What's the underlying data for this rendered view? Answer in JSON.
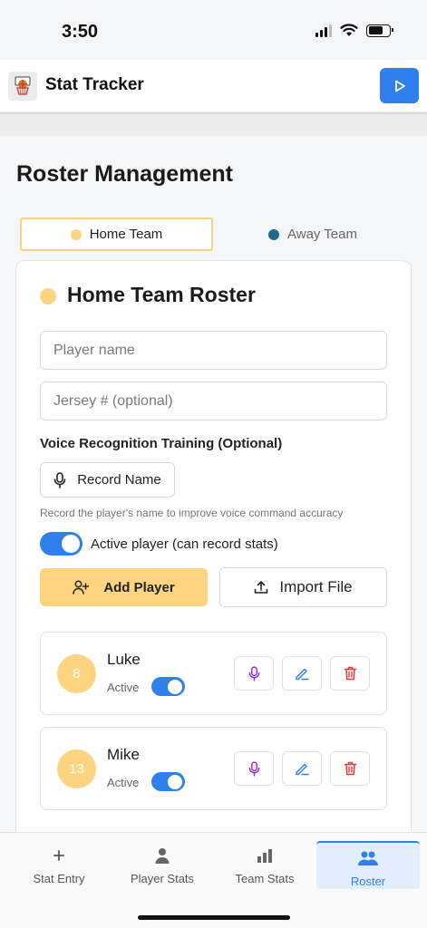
{
  "status_bar": {
    "time": "3:50"
  },
  "header": {
    "title": "Stat Tracker",
    "logo_icon": "basketball-hoop-icon",
    "action_icon": "play-icon"
  },
  "page": {
    "title": "Roster Management"
  },
  "team_tabs": [
    {
      "label": "Home Team",
      "color": "#fdd580",
      "selected": true
    },
    {
      "label": "Away Team",
      "color": "#1a6b8c",
      "selected": false
    }
  ],
  "roster": {
    "title": "Home Team Roster",
    "name_placeholder": "Player name",
    "jersey_placeholder": "Jersey # (optional)",
    "voice_label": "Voice Recognition Training (Optional)",
    "record_label": "Record Name",
    "hint": "Record the player's name to improve voice command accuracy",
    "active_label": "Active player (can record stats)",
    "active_on": true,
    "add_label": "Add Player",
    "import_label": "Import File"
  },
  "players": [
    {
      "number": "8",
      "name": "Luke",
      "status": "Active",
      "active": true
    },
    {
      "number": "13",
      "name": "Mike",
      "status": "Active",
      "active": true
    }
  ],
  "nav": [
    {
      "label": "Stat Entry",
      "icon": "plus-icon",
      "active": false
    },
    {
      "label": "Player Stats",
      "icon": "person-icon",
      "active": false
    },
    {
      "label": "Team Stats",
      "icon": "bar-chart-icon",
      "active": false
    },
    {
      "label": "Roster",
      "icon": "people-icon",
      "active": true
    }
  ],
  "colors": {
    "accent": "#2f80ed",
    "home": "#fdd580",
    "away": "#1a6b8c",
    "mic": "#9b30d9",
    "delete": "#e53935"
  }
}
